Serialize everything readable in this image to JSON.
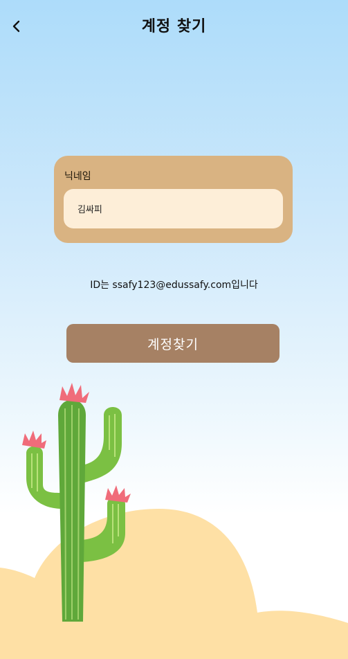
{
  "header": {
    "title": "계정 찾기",
    "back_icon": "chevron-left-icon"
  },
  "form": {
    "nickname_label": "닉네임",
    "nickname_value": "김싸피"
  },
  "result": {
    "message": "ID는 ssafy123@edussafy.com입니다"
  },
  "actions": {
    "find_account_label": "계정찾기"
  },
  "colors": {
    "sky_top": "#addcfa",
    "card": "#d9b382",
    "input": "#fdeed8",
    "button": "#a68164",
    "sand": "#fee0a5",
    "cactus": "#7bc043",
    "flower": "#f06c7a"
  }
}
